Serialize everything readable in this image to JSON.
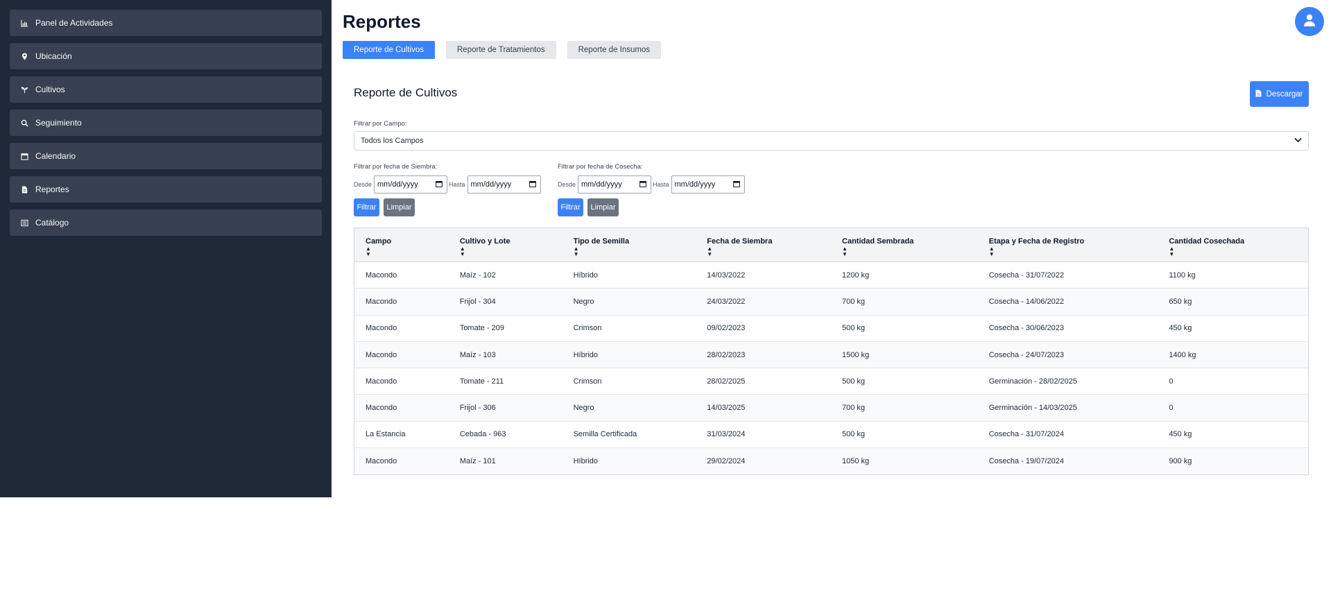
{
  "sidebar": {
    "items": [
      {
        "label": "Panel de Actividades",
        "icon": "chart-icon"
      },
      {
        "label": "Ubicación",
        "icon": "map-pin-icon"
      },
      {
        "label": "Cultivos",
        "icon": "seedling-icon"
      },
      {
        "label": "Seguimiento",
        "icon": "search-icon"
      },
      {
        "label": "Calendario",
        "icon": "calendar-icon"
      },
      {
        "label": "Reportes",
        "icon": "file-icon"
      },
      {
        "label": "Catálogo",
        "icon": "list-icon"
      }
    ]
  },
  "header": {
    "title": "Reportes",
    "avatar_icon": "user-icon"
  },
  "tabs": [
    {
      "label": "Reporte de Cultivos",
      "active": true
    },
    {
      "label": "Reporte de Tratamientos",
      "active": false
    },
    {
      "label": "Reporte de Insumos",
      "active": false
    }
  ],
  "report": {
    "title": "Reporte de Cultivos",
    "download_label": "Descargar",
    "campo_filter_label": "Filtrar por Campo:",
    "campo_selected": "Todos los Campos",
    "siembra_label": "Filtrar por fecha de Siembra:",
    "cosecha_label": "Filtrar por fecha de Cosecha:",
    "desde": "Desde",
    "hasta": "Hasta",
    "date_placeholder": "mm/dd/yyyy",
    "filter_btn": "Filtrar",
    "clear_btn": "Limpiar"
  },
  "table": {
    "columns": [
      "Campo",
      "Cultivo y Lote",
      "Tipo de Semilla",
      "Fecha de Siembra",
      "Cantidad Sembrada",
      "Etapa y Fecha de Registro",
      "Cantidad Cosechada"
    ],
    "rows": [
      [
        "Macondo",
        "Maíz - 102",
        "Híbrido",
        "14/03/2022",
        "1200 kg",
        "Cosecha - 31/07/2022",
        "1100 kg"
      ],
      [
        "Macondo",
        "Frijol - 304",
        "Negro",
        "24/03/2022",
        "700 kg",
        "Cosecha - 14/06/2022",
        "650 kg"
      ],
      [
        "Macondo",
        "Tomate - 209",
        "Crimson",
        "09/02/2023",
        "500 kg",
        "Cosecha - 30/06/2023",
        "450 kg"
      ],
      [
        "Macondo",
        "Maíz - 103",
        "Híbrido",
        "28/02/2023",
        "1500 kg",
        "Cosecha - 24/07/2023",
        "1400 kg"
      ],
      [
        "Macondo",
        "Tomate - 211",
        "Crimson",
        "28/02/2025",
        "500 kg",
        "Germinación - 28/02/2025",
        "0"
      ],
      [
        "Macondo",
        "Frijol - 306",
        "Negro",
        "14/03/2025",
        "700 kg",
        "Germinación - 14/03/2025",
        "0"
      ],
      [
        "La Estancia",
        "Cebada - 963",
        "Semilla Certificada",
        "31/03/2024",
        "500 kg",
        "Cosecha - 31/07/2024",
        "450 kg"
      ],
      [
        "Macondo",
        "Maíz - 101",
        "Híbrido",
        "29/02/2024",
        "1050 kg",
        "Cosecha - 19/07/2024",
        "900 kg"
      ]
    ]
  },
  "colors": {
    "sidebar_bg": "#1f2937",
    "nav_item_bg": "#374151",
    "accent": "#3b82f6",
    "secondary": "#6b7280"
  }
}
